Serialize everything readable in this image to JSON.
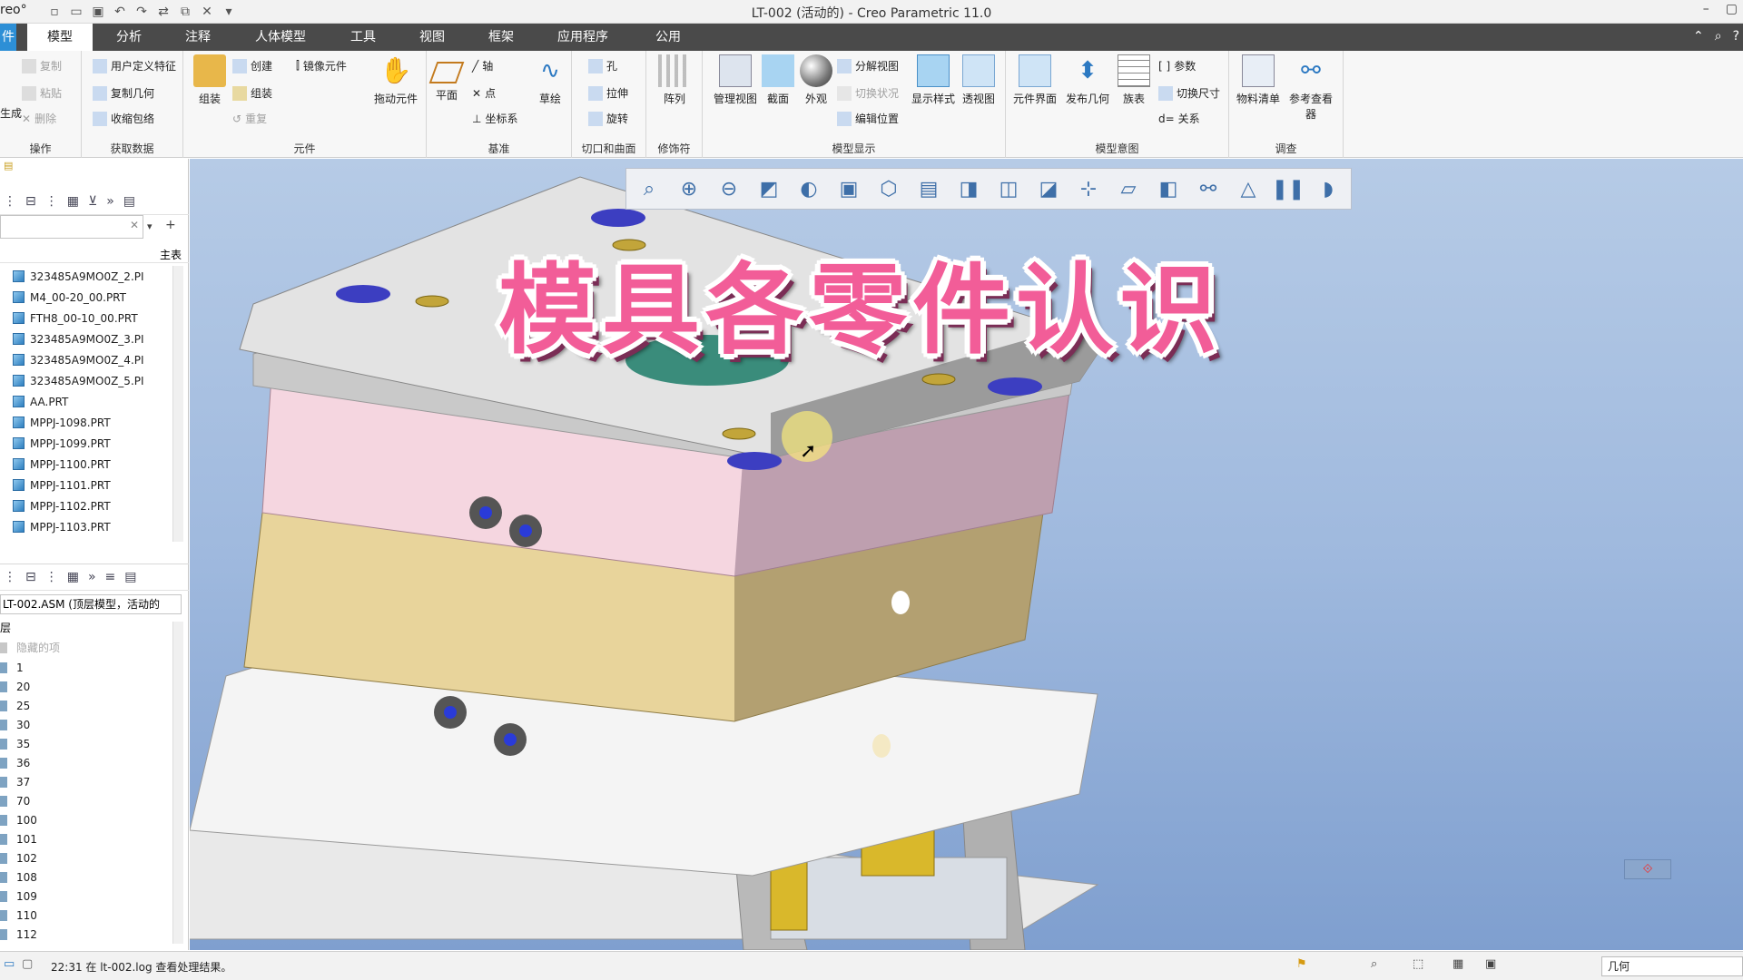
{
  "window": {
    "brand": "reo°",
    "title": "LT-002 (活动的) - Creo Parametric 11.0"
  },
  "menu": {
    "tabs": [
      "件",
      "模型",
      "分析",
      "注释",
      "人体模型",
      "工具",
      "视图",
      "框架",
      "应用程序",
      "公用"
    ],
    "active": "模型"
  },
  "ribbon": {
    "operations": {
      "label": "操作",
      "items": [
        "复制",
        "粘贴",
        "删除"
      ],
      "left_item": "生成"
    },
    "get_data": {
      "label": "获取数据",
      "items": [
        "用户定义特征",
        "复制几何",
        "收缩包络"
      ]
    },
    "components": {
      "label": "元件",
      "big": "组装",
      "items": [
        "创建",
        "组装",
        "重复"
      ],
      "mirror": "镜像元件",
      "drag": "拖动元件"
    },
    "datum": {
      "label": "基准",
      "plane": "平面",
      "items": [
        "轴",
        "点",
        "坐标系"
      ],
      "sketch": "草绘"
    },
    "cut_surface": {
      "label": "切口和曲面",
      "items": [
        "孔",
        "拉伸",
        "旋转"
      ]
    },
    "modifiers": {
      "label": "修饰符",
      "pattern": "阵列"
    },
    "model_display": {
      "label": "模型显示",
      "manage_views": "管理视图",
      "section": "截面",
      "appearance": "外观",
      "items": [
        "分解视图",
        "切换状况",
        "编辑位置"
      ],
      "display_style": "显示样式",
      "perspective": "透视图"
    },
    "model_intent": {
      "label": "模型意图",
      "component_interface": "元件界面",
      "publish_geometry": "发布几何",
      "family_table": "族表",
      "items": [
        "参数",
        "切换尺寸",
        "关系"
      ]
    },
    "investigate": {
      "label": "调查",
      "bom": "物料清单",
      "reference_viewer": "参考查看器"
    }
  },
  "model_tree": {
    "filter_header": "主表",
    "items": [
      "323485A9MO0Z_2.PI",
      "M4_00-20_00.PRT",
      "FTH8_00-10_00.PRT",
      "323485A9MO0Z_3.PI",
      "323485A9MO0Z_4.PI",
      "323485A9MO0Z_5.PI",
      "AA.PRT",
      "MPPJ-1098.PRT",
      "MPPJ-1099.PRT",
      "MPPJ-1100.PRT",
      "MPPJ-1101.PRT",
      "MPPJ-1102.PRT",
      "MPPJ-1103.PRT"
    ]
  },
  "layer_tree": {
    "selector": "LT-002.ASM (顶层模型，活动的",
    "header": "层",
    "hidden_label": "隐藏的项",
    "items": [
      "1",
      "20",
      "25",
      "30",
      "35",
      "36",
      "37",
      "70",
      "100",
      "101",
      "102",
      "108",
      "109",
      "110",
      "112"
    ]
  },
  "viewport": {
    "overlay_title": "模具各零件认识"
  },
  "status": {
    "message": "22:31 在 lt-002.log 查看处理结果。",
    "filter": "几何"
  },
  "colors": {
    "menubar": "#4a4a4a",
    "accent": "#2d8fd6",
    "overlay_text": "#f25d98"
  }
}
